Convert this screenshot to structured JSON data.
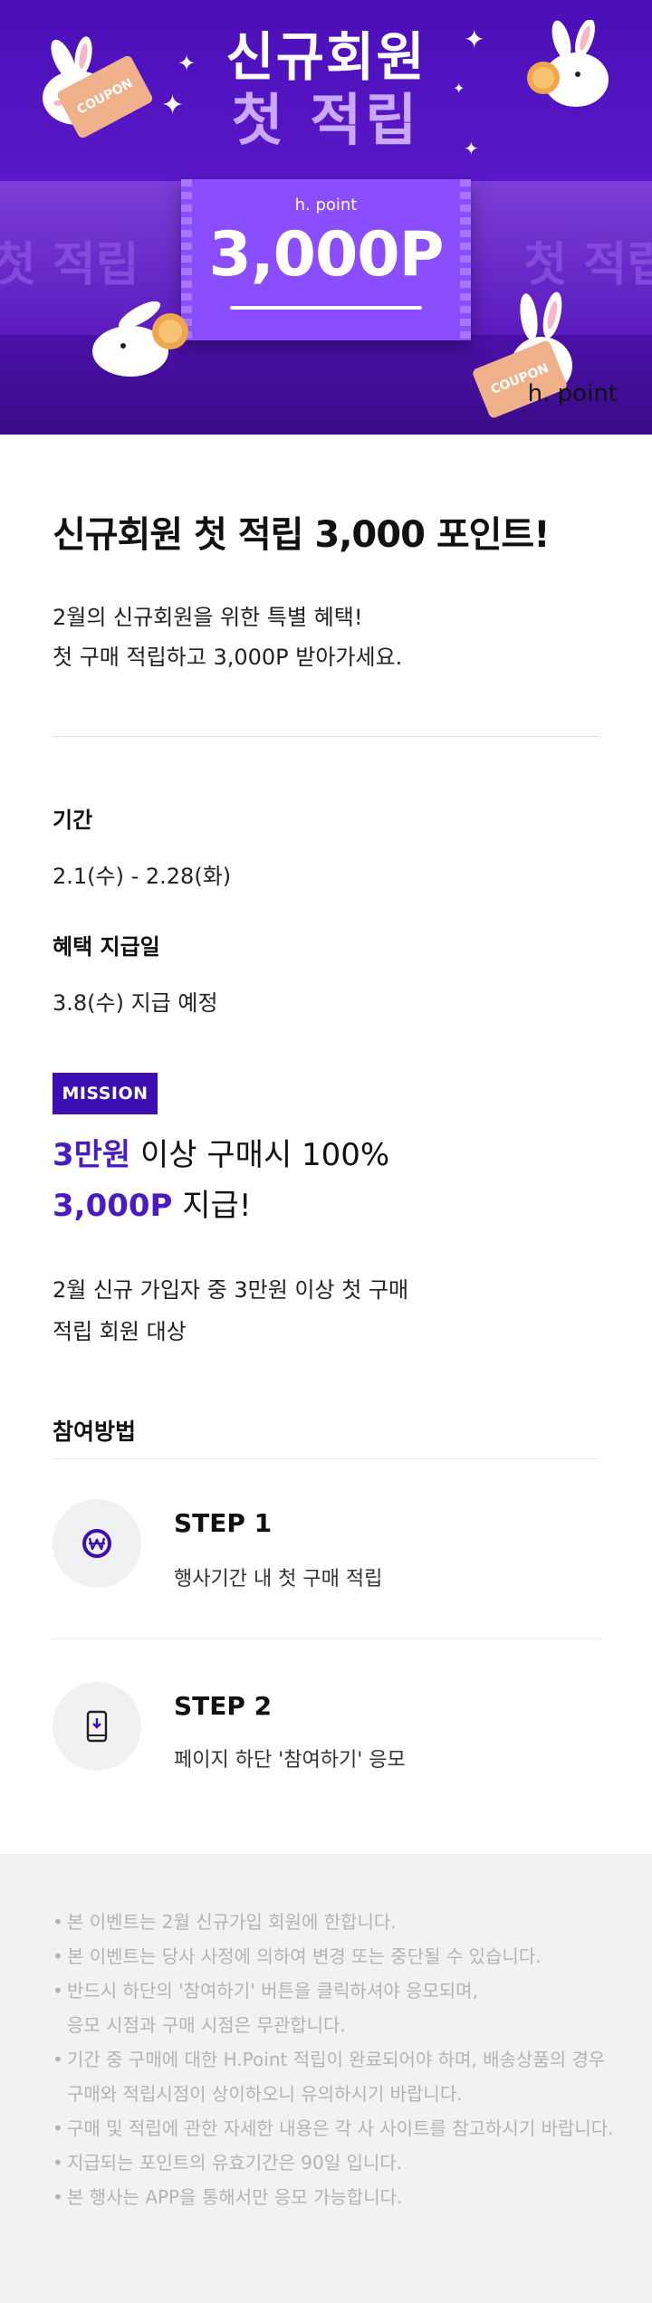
{
  "hero": {
    "title_line1": "신규회원",
    "title_line2": "첫 적립",
    "band_text": "첫 적립",
    "ticket_brand": "h. point",
    "ticket_amount": "3,000P",
    "coupon_label": "COUPON",
    "logo_text": "h. point",
    "colors": {
      "background": "#5a18c9",
      "ticket": "#8a4dff",
      "accent": "#c9a8ff"
    }
  },
  "main": {
    "title": "신규회원 첫 적립 3,000 포인트!",
    "desc_line1": "2월의 신규회원을 위한 특별 혜택!",
    "desc_line2": "첫 구매 적립하고 3,000P 받아가세요."
  },
  "period": {
    "label": "기간",
    "value": "2.1(수) - 2.28(화)"
  },
  "payment": {
    "label": "혜택 지급일",
    "value": "3.8(수) 지급 예정"
  },
  "mission": {
    "badge": "MISSION",
    "line1_accent": "3만원",
    "line1_rest": " 이상 구매시 100%",
    "line2_accent": "3,000P",
    "line2_rest": " 지급!",
    "sub_line1": "2월 신규 가입자 중 3만원 이상 첫 구매",
    "sub_line2": "적립 회원 대상",
    "accent_color": "#4a1bc4"
  },
  "how": {
    "title": "참여방법",
    "steps": [
      {
        "title": "STEP 1",
        "desc": "행사기간 내 첫 구매 적립",
        "icon": "won-coin-icon"
      },
      {
        "title": "STEP 2",
        "desc": "페이지 하단 '참여하기' 응모",
        "icon": "phone-download-icon"
      }
    ]
  },
  "notice": [
    "본 이벤트는 2월 신규가입 회원에 한합니다.",
    "본 이벤트는 당사 사정에 의하여 변경 또는 중단될 수 있습니다.",
    "반드시 하단의 '참여하기' 버튼을 클릭하셔야 응모되며,\n응모 시점과 구매 시점은 무관합니다.",
    "기간 중 구매에 대한 H.Point 적립이 완료되어야 하며, 배송상품의 경우 구매와 적립시점이 상이하오니 유의하시기 바랍니다.",
    "구매 및 적립에 관한 자세한 내용은 각 사 사이트를 참고하시기 바랍니다.",
    "지급되는 포인트의 유효기간은 90일 입니다.",
    "본 행사는 APP을 통해서만 응모 가능합니다."
  ]
}
